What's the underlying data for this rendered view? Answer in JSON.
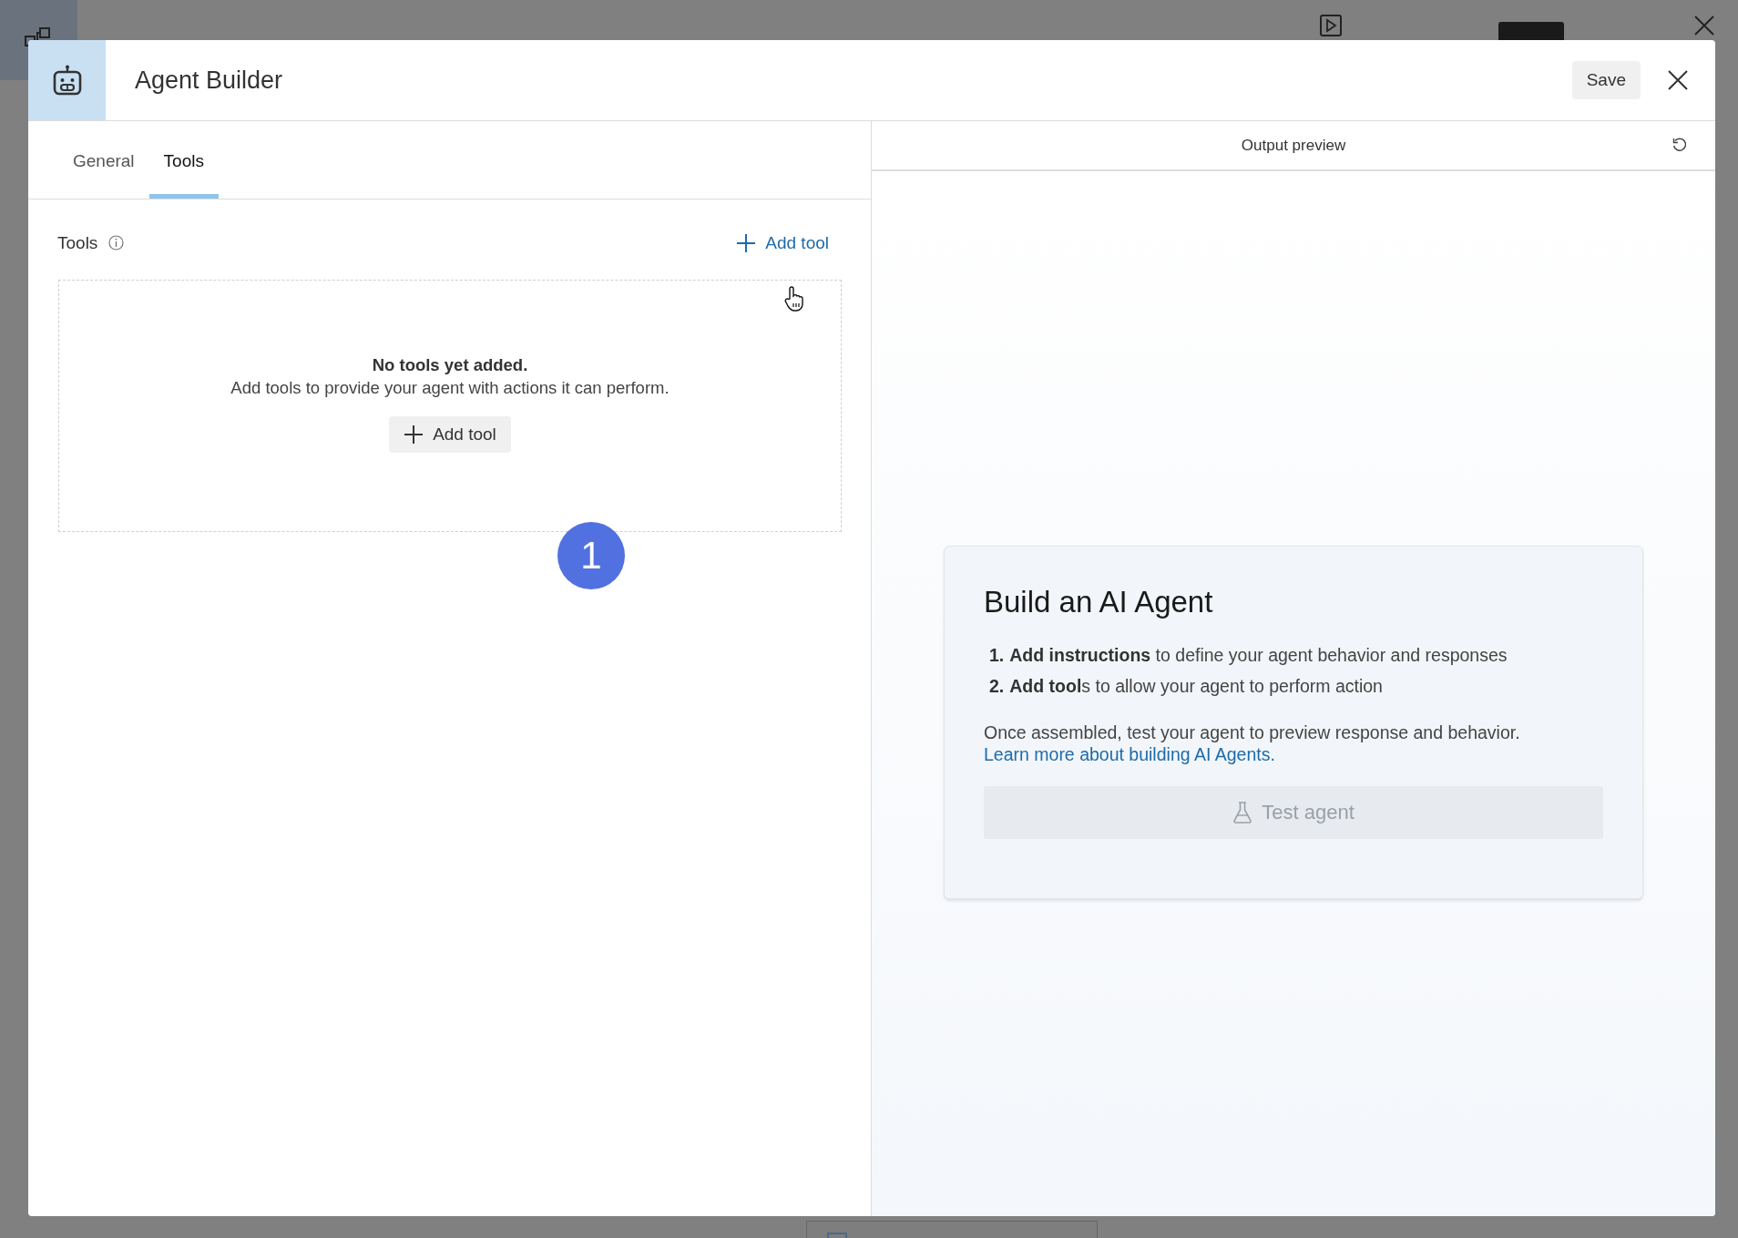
{
  "modal": {
    "title": "Agent Builder",
    "save": "Save"
  },
  "tabs": [
    {
      "label": "General",
      "selected": false
    },
    {
      "label": "Tools",
      "selected": true
    }
  ],
  "tools": {
    "label": "Tools",
    "add_link": "Add tool",
    "empty_title": "No tools yet added.",
    "empty_text": "Add tools to provide your agent with actions it can perform.",
    "add_button": "Add tool"
  },
  "step_badge": "1",
  "preview": {
    "title": "Output preview",
    "card": {
      "heading": "Build an AI Agent",
      "steps": [
        {
          "number": "1.",
          "text": "**Add instructions** to define your agent behavior and responses"
        },
        {
          "number": "2.",
          "text": "**Add tool**s to allow your agent to perform action"
        }
      ],
      "note": "Once assembled, test your agent to preview response and behavior.",
      "link": "Learn more about building AI Agents.",
      "button": {
        "label": "Test agent",
        "disabled": true
      }
    }
  }
}
